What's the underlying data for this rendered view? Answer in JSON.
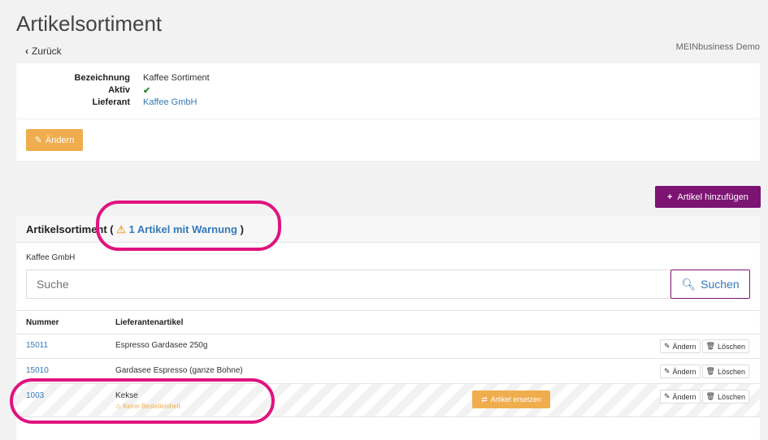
{
  "header": {
    "title": "Artikelsortiment",
    "back_label": "Zurück",
    "company": "MEINbusiness Demo"
  },
  "details": {
    "bezeichnung_label": "Bezeichnung",
    "bezeichnung_value": "Kaffee Sortiment",
    "aktiv_label": "Aktiv",
    "lieferant_label": "Lieferant",
    "lieferant_value": "Kaffee GmbH",
    "edit_label": "Ändern"
  },
  "add_button_label": "Artikel hinzufügen",
  "sortiment": {
    "title": "Artikelsortiment (",
    "warning_link": "1 Artikel mit Warnung",
    "title_close": ")",
    "supplier": "Kaffee GmbH",
    "search_placeholder": "Suche",
    "search_button": "Suchen",
    "columns": [
      "Nummer",
      "Lieferantenartikel"
    ],
    "rows": [
      {
        "nummer": "15011",
        "artikel": "Espresso Gardasee 250g"
      },
      {
        "nummer": "15010",
        "artikel": "Gardasee Espresso (ganze Bohne)"
      },
      {
        "nummer": "1003",
        "artikel": "Kekse",
        "warning": "Keine Bestelleinheit",
        "replace_label": "Artikel ersetzen"
      }
    ],
    "row_edit": "Ändern",
    "row_delete": "Löschen"
  },
  "colors": {
    "orange": "#f0ad4e",
    "purple": "#7b1473",
    "link": "#337ab7",
    "annotation": "#e0137f"
  }
}
